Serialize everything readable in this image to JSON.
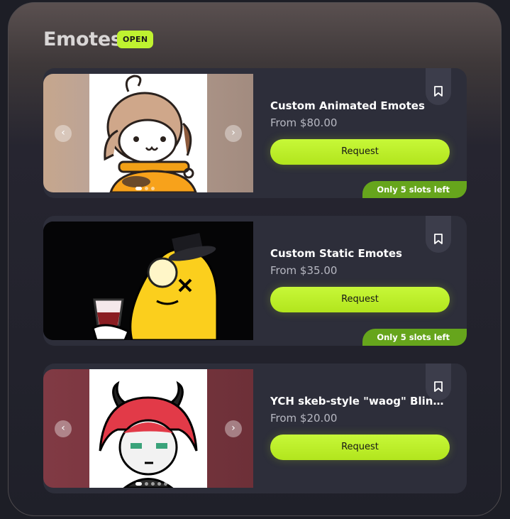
{
  "section": {
    "title": "Emotes",
    "status_badge": "OPEN"
  },
  "cards": [
    {
      "name": "Custom Animated Emotes",
      "price": "From $80.00",
      "request_label": "Request",
      "slots": "Only 5 slots left",
      "carousel": {
        "prev": "‹",
        "next": "›"
      }
    },
    {
      "name": "Custom Static Emotes",
      "price": "From $35.00",
      "request_label": "Request",
      "slots": "Only 5 slots left"
    },
    {
      "name": "YCH skeb-style \"waog\" Blinking Emote",
      "price": "From $20.00",
      "request_label": "Request",
      "carousel": {
        "prev": "‹",
        "next": "›"
      }
    }
  ],
  "colors": {
    "accent": "#bff230",
    "slots_badge": "#66a51c",
    "card_bg": "#2d2e3a"
  }
}
